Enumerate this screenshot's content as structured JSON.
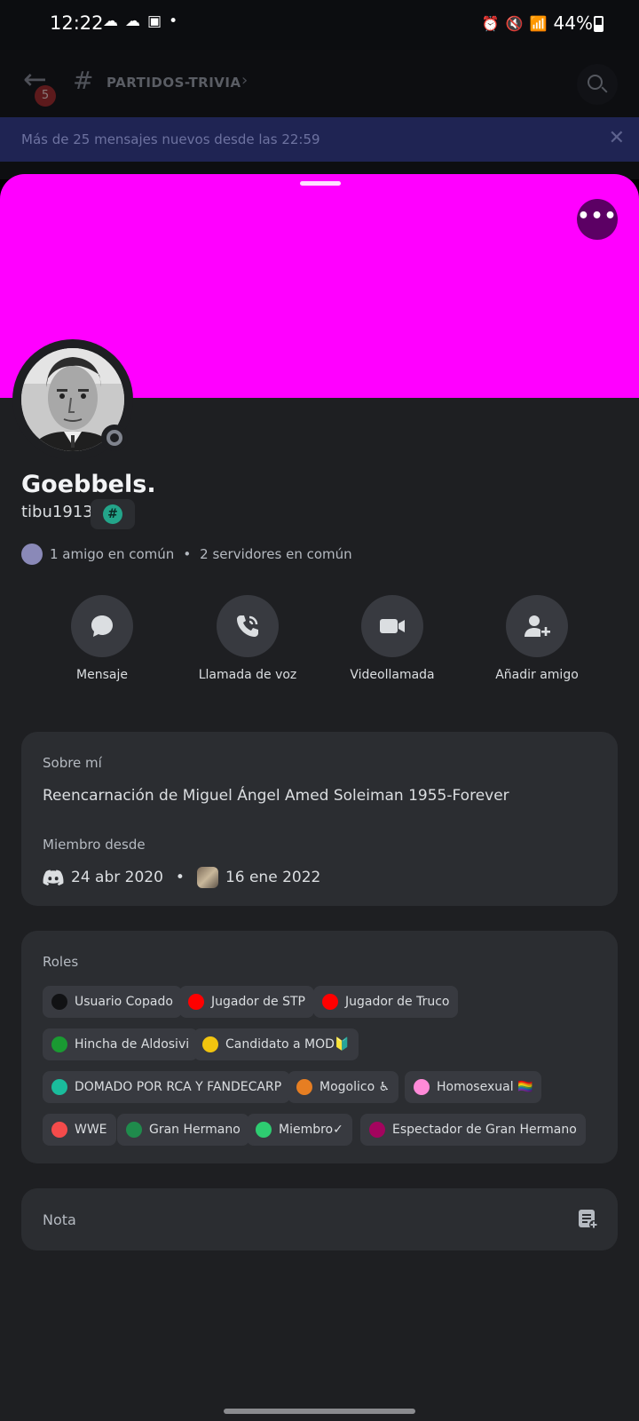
{
  "status_bar": {
    "time": "12:22",
    "battery": "44%"
  },
  "chat_header": {
    "back_badge": "5",
    "channel_name": "PARTIDOS-TRIVIA",
    "new_messages": "Más de 25 mensajes nuevos desde las 22:59",
    "close": "✕"
  },
  "profile": {
    "banner_color": "#ff00ff",
    "display_name": "Goebbels.",
    "username": "tibu1913",
    "tag_symbol": "#",
    "more_label": "•••",
    "mutual_friends": "1 amigo en común",
    "mutual_sep": "•",
    "mutual_servers": "2 servidores en común"
  },
  "actions": [
    {
      "label": "Mensaje",
      "icon": "message-icon"
    },
    {
      "label": "Llamada de voz",
      "icon": "phone-icon"
    },
    {
      "label": "Videollamada",
      "icon": "video-icon"
    },
    {
      "label": "Añadir amigo",
      "icon": "add-friend-icon"
    }
  ],
  "about": {
    "title": "Sobre mí",
    "text": "Reencarnación de Miguel Ángel Amed Soleiman 1955-Forever",
    "member_title": "Miembro desde",
    "discord_date": "24 abr 2020",
    "sep": "•",
    "server_date": "16 ene 2022"
  },
  "roles": {
    "title": "Roles",
    "items": [
      {
        "name": "Usuario Copado",
        "color": "#111214"
      },
      {
        "name": "Jugador de STP",
        "color": "#ff0000"
      },
      {
        "name": "Jugador de Truco",
        "color": "#ff0000"
      },
      {
        "name": "Hincha de Aldosivi",
        "color": "#1a9a32"
      },
      {
        "name": "Candidato a MOD🔰",
        "color": "#f1c40f"
      },
      {
        "name": "DOMADO POR RCA Y FANDECARP",
        "color": "#1abc9c"
      },
      {
        "name": "Mogolico ♿",
        "color": "#e67e22"
      },
      {
        "name": "Homosexual 🏳️‍🌈",
        "color": "#ff8ad8"
      },
      {
        "name": "WWE",
        "color": "#f44b4b"
      },
      {
        "name": "Gran Hermano",
        "color": "#1f8b4c"
      },
      {
        "name": "Miembro✓",
        "color": "#2ecc71"
      },
      {
        "name": "Espectador de Gran Hermano",
        "color": "#a3045e"
      }
    ]
  },
  "note": {
    "title": "Nota"
  }
}
